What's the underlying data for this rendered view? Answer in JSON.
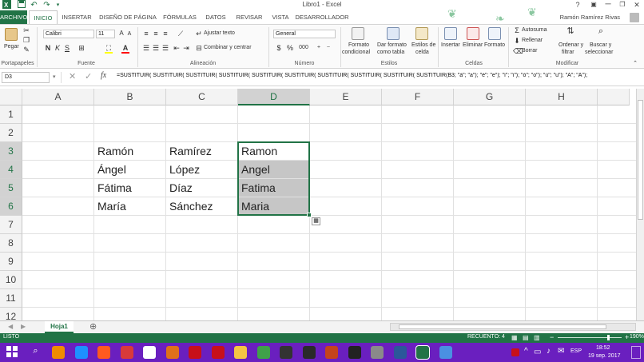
{
  "window": {
    "title": "Libro1 - Excel",
    "minimize_glyph": "─",
    "restore_glyph": "❐",
    "close_glyph": "✕",
    "help_glyph": "?",
    "ribbon_opts_glyph": "▣"
  },
  "quick_access": {
    "save_icon": "save-icon",
    "undo_icon": "undo-icon",
    "redo_icon": "redo-icon"
  },
  "ribbon_tabs": [
    "ARCHIVO",
    "INICIO",
    "INSERTAR",
    "DISEÑO DE PÁGINA",
    "FÓRMULAS",
    "DATOS",
    "REVISAR",
    "VISTA",
    "DESARROLLADOR"
  ],
  "user": {
    "name": "Ramón Ramírez Rivas"
  },
  "ribbon": {
    "clipboard": {
      "paste": "Pegar",
      "label": "Portapapeles"
    },
    "font": {
      "name": "Calibri",
      "size": "11",
      "bold": "N",
      "italic": "K",
      "underline": "S",
      "grow": "A",
      "shrink": "A",
      "fill_color": "#ffff00",
      "font_color": "#ff0000",
      "label": "Fuente"
    },
    "alignment": {
      "wrap": "Ajustar texto",
      "merge": "Combinar y centrar",
      "label": "Alineación"
    },
    "number": {
      "format": "General",
      "currency": "$",
      "percent": "%",
      "thousands": "000",
      "label": "Número"
    },
    "styles": {
      "conditional": [
        "Formato",
        "condicional"
      ],
      "table": [
        "Dar formato",
        "como tabla"
      ],
      "cell_styles": [
        "Estilos de",
        "celda"
      ],
      "label": "Estilos"
    },
    "cells": {
      "insert": "Insertar",
      "delete": "Eliminar",
      "format": "Formato",
      "label": "Celdas"
    },
    "editing": {
      "autosum": "Autosuma",
      "fill": "Rellenar",
      "clear": "Borrar",
      "sort": [
        "Ordenar y",
        "filtrar"
      ],
      "find": [
        "Buscar y",
        "seleccionar"
      ],
      "label": "Modificar"
    }
  },
  "formula_bar": {
    "name_box": "D3",
    "fx": "fx",
    "formula": "=SUSTITUIR( SUSTITUIR( SUSTITUIR( SUSTITUIR( SUSTITUIR( SUSTITUIR( SUSTITUIR( SUSTITUIR( SUSTITUIR( SUSTITUIR(B3; \"á\"; \"a\"); \"é\"; \"e\"); \"í\"; \"i\"); \"ó\"; \"o\"); \"ú\"; \"u\"); \"Á\"; \"A\");"
  },
  "grid": {
    "columns": [
      "A",
      "B",
      "C",
      "D",
      "E",
      "F",
      "G",
      "H"
    ],
    "rows": [
      "1",
      "2",
      "3",
      "4",
      "5",
      "6",
      "7",
      "8",
      "9",
      "10",
      "11",
      "12"
    ],
    "cells": {
      "B3": "Ramón",
      "C3": "Ramírez",
      "D3": "Ramon",
      "B4": "Ángel",
      "C4": "López",
      "D4": "Angel",
      "B5": "Fátima",
      "C5": "Díaz",
      "D5": "Fatima",
      "B6": "María",
      "C6": "Sánchez",
      "D6": "Maria"
    },
    "selected_column": "D",
    "selected_rows": [
      "3",
      "4",
      "5",
      "6"
    ]
  },
  "sheets": {
    "tabs": [
      "Hoja1"
    ],
    "add_glyph": "⊕"
  },
  "status": {
    "mode": "LISTO",
    "count": "RECUENTO: 4",
    "zoom": "190%",
    "zoom_minus": "−",
    "zoom_plus": "+"
  },
  "taskbar": {
    "lang": "ESP",
    "time": "18:52",
    "date": "19 sep. 2017",
    "apps": [
      "windows-icon",
      "search-icon",
      "vlc-icon",
      "paint-icon",
      "chrome-icon",
      "photos-icon",
      "media-icon",
      "firefox-icon",
      "filezilla-icon",
      "opera-icon",
      "explorer-icon",
      "maps-icon",
      "obs-icon",
      "audacity-icon",
      "powerpoint-icon",
      "ez-icon",
      "notepad-icon",
      "word-icon",
      "excel-icon",
      "chrome2-icon"
    ],
    "app_colors": [
      "#ffffff",
      "#ffffff",
      "#f08c00",
      "#1e90ff",
      "#ff5a1f",
      "#d93a3a",
      "#ffffff",
      "#e0701a",
      "#c8101a",
      "#c8101a",
      "#f5c443",
      "#3fa14a",
      "#333333",
      "#2a2a2a",
      "#c5431c",
      "#222222",
      "#8a8a8a",
      "#2b579a",
      "#217346",
      "#4a90e2"
    ]
  }
}
